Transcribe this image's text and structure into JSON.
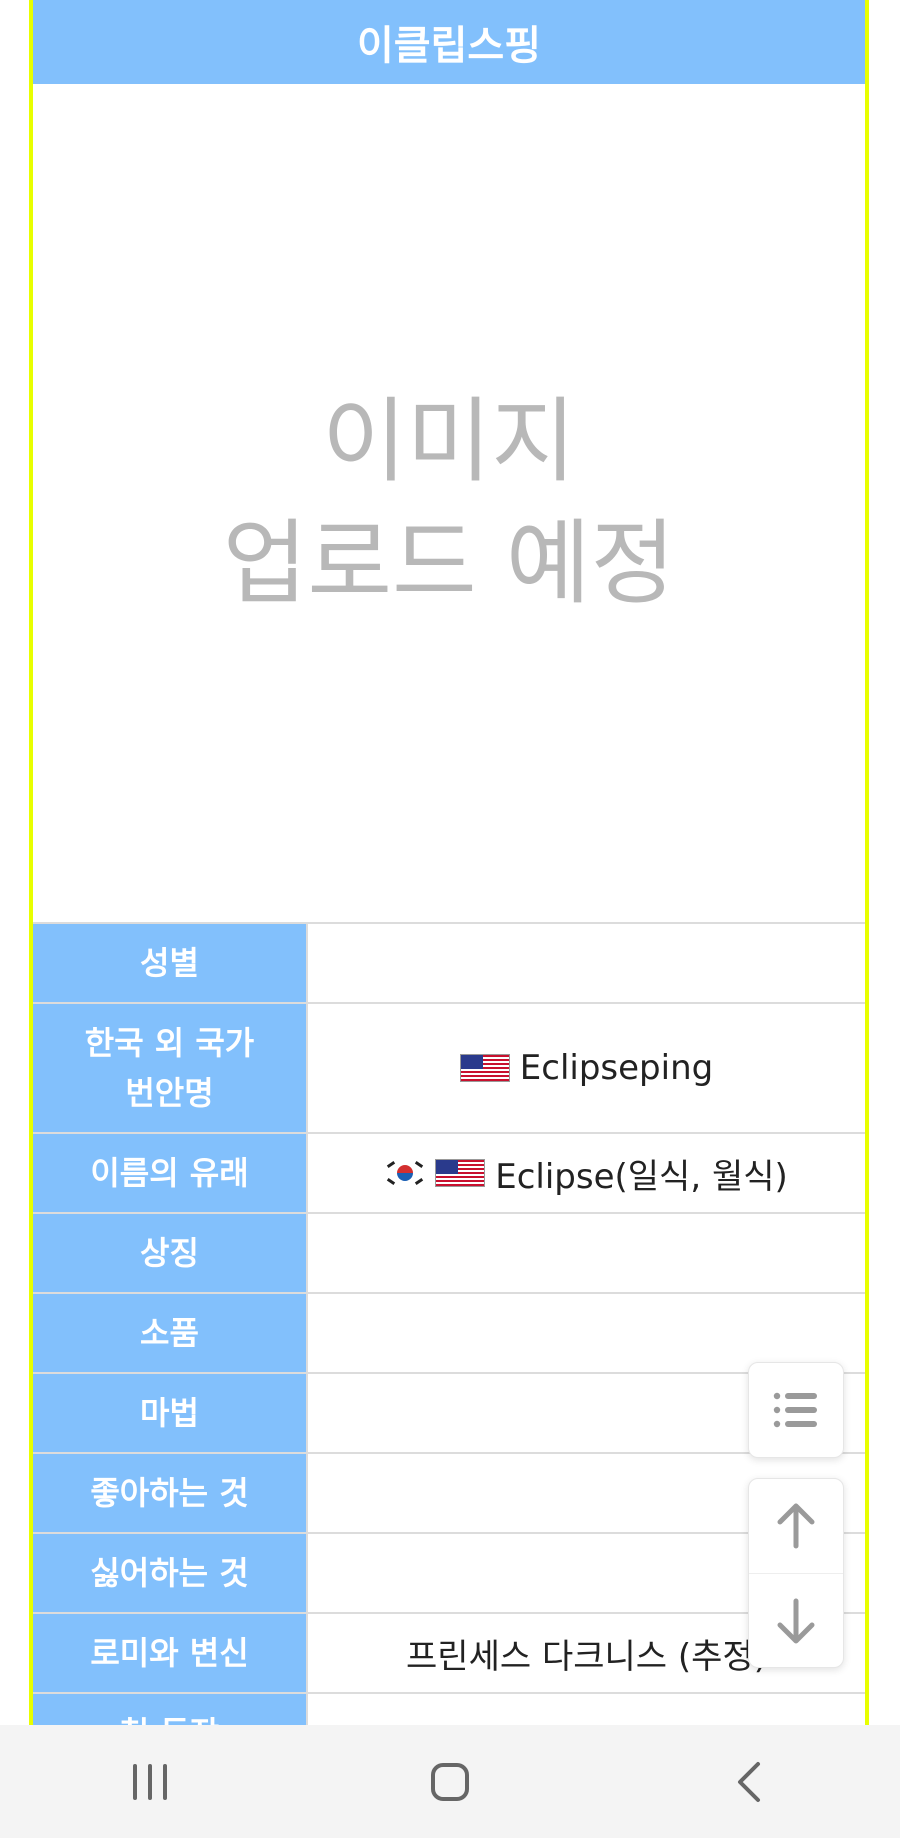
{
  "title": "이클립스핑",
  "image_placeholder": {
    "line1": "이미지",
    "line2": "업로드 예정"
  },
  "info_table": [
    {
      "label": "성별",
      "value": ""
    },
    {
      "label_line1": "한국 외 국가",
      "label_line2": "번안명",
      "value": "Eclipseping",
      "flags": [
        "us"
      ]
    },
    {
      "label": "이름의 유래",
      "value": "Eclipse(일식, 월식)",
      "flags": [
        "kr",
        "us"
      ]
    },
    {
      "label": "상징",
      "value": ""
    },
    {
      "label": "소품",
      "value": ""
    },
    {
      "label": "마법",
      "value": ""
    },
    {
      "label": "좋아하는 것",
      "value": ""
    },
    {
      "label": "싫어하는 것",
      "value": ""
    },
    {
      "label": "로미와 변신",
      "value": "프린세스 다크니스 (추정)"
    },
    {
      "label": "첫 등장",
      "value": ""
    }
  ],
  "floating_buttons": {
    "toc_icon": "list-icon",
    "up_icon": "arrow-up-icon",
    "down_icon": "arrow-down-icon"
  },
  "navbar": {
    "icons": [
      "recent-apps-icon",
      "home-icon",
      "back-icon"
    ]
  },
  "colors": {
    "accent": "#82c0fc",
    "frame_border": "#e8ff00",
    "placeholder_text": "#b8b8b8"
  }
}
